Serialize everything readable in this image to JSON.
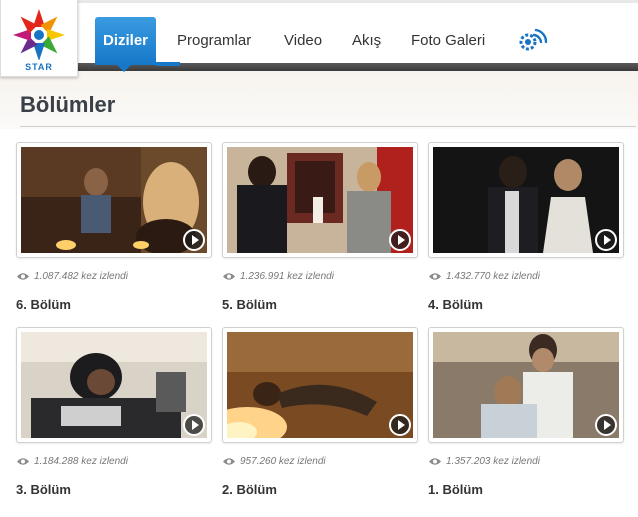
{
  "logo": {
    "text": "STAR"
  },
  "nav": {
    "items": [
      {
        "label": "Diziler",
        "active": true
      },
      {
        "label": "Programlar",
        "active": false
      },
      {
        "label": "Video",
        "active": false
      },
      {
        "label": "Akış",
        "active": false
      },
      {
        "label": "Foto Galeri",
        "active": false
      }
    ],
    "extra_icon": "signal-icon"
  },
  "page": {
    "title": "Bölümler"
  },
  "episodes": [
    {
      "title": "6. Bölüm",
      "views": "1.087.482 kez izlendi"
    },
    {
      "title": "5. Bölüm",
      "views": "1.236.991 kez izlendi"
    },
    {
      "title": "4. Bölüm",
      "views": "1.432.770 kez izlendi"
    },
    {
      "title": "3. Bölüm",
      "views": "1.184.288 kez izlendi"
    },
    {
      "title": "2. Bölüm",
      "views": "957.260 kez izlendi"
    },
    {
      "title": "1. Bölüm",
      "views": "1.357.203 kez izlendi"
    }
  ],
  "colors": {
    "accent": "#1678c9",
    "header_bar": "#3a3a3a",
    "title": "#3a4048"
  }
}
